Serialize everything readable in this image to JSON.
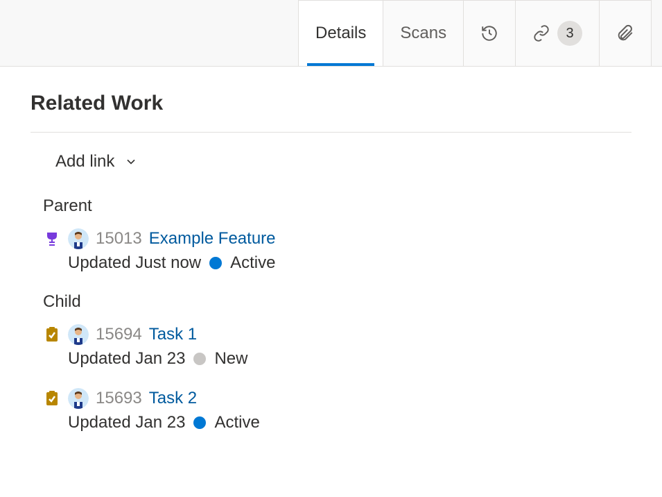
{
  "tabs": {
    "details": "Details",
    "scans": "Scans",
    "links_count": "3"
  },
  "section": {
    "title": "Related Work",
    "add_link": "Add link"
  },
  "groups": {
    "parent": {
      "label": "Parent",
      "items": [
        {
          "id": "15013",
          "title": "Example Feature",
          "updated": "Updated Just now",
          "status": "Active",
          "status_class": "active",
          "type": "feature"
        }
      ]
    },
    "child": {
      "label": "Child",
      "items": [
        {
          "id": "15694",
          "title": "Task 1",
          "updated": "Updated Jan 23",
          "status": "New",
          "status_class": "new",
          "type": "task"
        },
        {
          "id": "15693",
          "title": "Task 2",
          "updated": "Updated Jan 23",
          "status": "Active",
          "status_class": "active",
          "type": "task"
        }
      ]
    }
  }
}
